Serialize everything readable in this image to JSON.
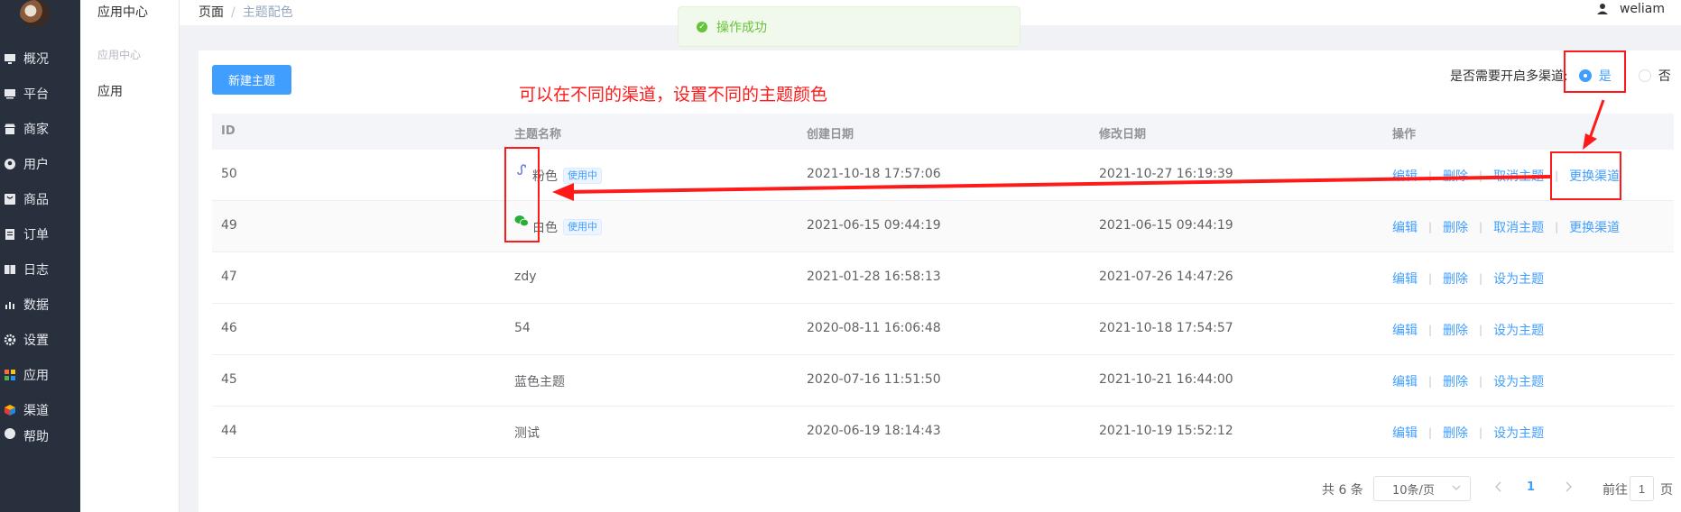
{
  "sidebar": {
    "items": [
      {
        "label": "概况",
        "icon": "monitor-icon"
      },
      {
        "label": "平台",
        "icon": "desktop-icon"
      },
      {
        "label": "商家",
        "icon": "store-icon"
      },
      {
        "label": "用户",
        "icon": "user-icon"
      },
      {
        "label": "商品",
        "icon": "goods-icon"
      },
      {
        "label": "订单",
        "icon": "order-icon"
      },
      {
        "label": "日志",
        "icon": "log-icon"
      },
      {
        "label": "数据",
        "icon": "chart-icon"
      },
      {
        "label": "设置",
        "icon": "gear-icon"
      },
      {
        "label": "应用",
        "icon": "apps-icon"
      },
      {
        "label": "渠道",
        "icon": "cube-icon"
      },
      {
        "label": "帮助",
        "icon": "help-icon"
      }
    ]
  },
  "subsidebar": {
    "title": "应用中心",
    "group": "应用中心",
    "item": "应用"
  },
  "breadcrumb": {
    "first": "页面",
    "separator": "/",
    "current": "主题配色"
  },
  "user": {
    "name": "weliam"
  },
  "toast": {
    "message": "操作成功"
  },
  "toolbar": {
    "new_label": "新建主题",
    "multi_channel_label": "是否需要开启多渠道:",
    "yes_label": "是",
    "no_label": "否",
    "multi_channel_value": "是"
  },
  "annotation": {
    "text": "可以在不同的渠道，设置不同的主题颜色"
  },
  "table": {
    "headers": {
      "id": "ID",
      "name": "主题名称",
      "created": "创建日期",
      "modified": "修改日期",
      "ops": "操作"
    },
    "rows": [
      {
        "id": "50",
        "name": "粉色",
        "in_use": "使用中",
        "created": "2021-10-18 17:57:06",
        "modified": "2021-10-27 16:19:39",
        "op1": "编辑",
        "op2": "删除",
        "op3": "取消主题",
        "op4": "更换渠道",
        "icon": "miniprogram-icon"
      },
      {
        "id": "49",
        "name": "白色",
        "in_use": "使用中",
        "created": "2021-06-15 09:44:19",
        "modified": "2021-06-15 09:44:19",
        "op1": "编辑",
        "op2": "删除",
        "op3": "取消主题",
        "op4": "更换渠道",
        "icon": "wechat-icon"
      },
      {
        "id": "47",
        "name": "zdy",
        "created": "2021-01-28 16:58:13",
        "modified": "2021-07-26 14:47:26",
        "op1": "编辑",
        "op2": "删除",
        "op3": "设为主题"
      },
      {
        "id": "46",
        "name": "54",
        "created": "2020-08-11 16:06:48",
        "modified": "2021-10-18 17:54:57",
        "op1": "编辑",
        "op2": "删除",
        "op3": "设为主题"
      },
      {
        "id": "45",
        "name": "蓝色主题",
        "created": "2020-07-16 11:51:50",
        "modified": "2021-10-21 16:44:00",
        "op1": "编辑",
        "op2": "删除",
        "op3": "设为主题"
      },
      {
        "id": "44",
        "name": "测试",
        "created": "2020-06-19 18:14:43",
        "modified": "2021-10-19 15:52:12",
        "op1": "编辑",
        "op2": "删除",
        "op3": "设为主题"
      }
    ]
  },
  "pagination": {
    "total": "共 6 条",
    "page_size": "10条/页",
    "current_page": "1",
    "goto_prefix": "前往",
    "goto_value": "1",
    "goto_suffix": "页"
  },
  "colors": {
    "primary": "#409eff",
    "sidebar_bg": "#28303d",
    "success": "#67c23a",
    "annotation": "#ff1a1a"
  }
}
